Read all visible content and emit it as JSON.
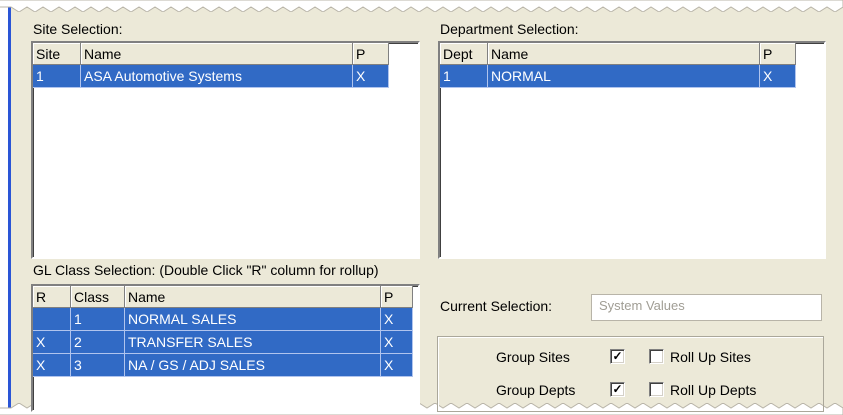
{
  "site_selection": {
    "title": "Site Selection:",
    "columns": [
      "Site",
      "Name",
      "P"
    ],
    "rows": [
      {
        "site": "1",
        "name": "ASA Automotive Systems",
        "p": "X"
      }
    ]
  },
  "department_selection": {
    "title": "Department Selection:",
    "columns": [
      "Dept",
      "Name",
      "P"
    ],
    "rows": [
      {
        "dept": "1",
        "name": "NORMAL",
        "p": "X"
      }
    ]
  },
  "gl_class_selection": {
    "title": "GL Class Selection: (Double Click \"R\" column for rollup)",
    "columns": [
      "R",
      "Class",
      "Name",
      "P"
    ],
    "rows": [
      {
        "r": "",
        "class": "1",
        "name": "NORMAL SALES",
        "p": "X"
      },
      {
        "r": "X",
        "class": "2",
        "name": "TRANSFER SALES",
        "p": "X"
      },
      {
        "r": "X",
        "class": "3",
        "name": "NA / GS / ADJ SALES",
        "p": "X"
      }
    ]
  },
  "current_selection": {
    "label": "Current Selection:",
    "value": "System Values"
  },
  "options": {
    "group_sites": {
      "label": "Group Sites",
      "checked": true,
      "mark": "✓"
    },
    "roll_up_sites": {
      "label": "Roll Up Sites",
      "checked": false,
      "mark": ""
    },
    "group_depts": {
      "label": "Group Depts",
      "checked": true,
      "mark": "✓"
    },
    "roll_up_depts": {
      "label": "Roll Up Depts",
      "checked": false,
      "mark": ""
    }
  },
  "colors": {
    "selection": "#316ac5",
    "window_bg": "#ece9d8",
    "left_accent": "#2a55d6"
  }
}
